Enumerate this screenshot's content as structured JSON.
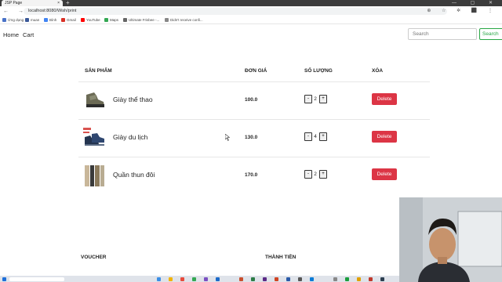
{
  "browser": {
    "tab_title": "JSP Page",
    "tab_close": "×",
    "new_tab": "+",
    "window_controls": "— ▢ ✕",
    "nav_buttons": "← → ⟳",
    "url": "localhost:8080/Wish/print",
    "right_icons": "⊕ ☆ ✲ ⬛ ⋮",
    "bookmarks": [
      {
        "label": "Ứng dụng",
        "color": "#4a73c8"
      },
      {
        "label": "muan",
        "color": "#3b5998"
      },
      {
        "label": "Bình",
        "color": "#4285f4"
      },
      {
        "label": "Gmail",
        "color": "#d93025"
      },
      {
        "label": "YouTube",
        "color": "#ff0000"
      },
      {
        "label": "Maps",
        "color": "#34a853"
      },
      {
        "label": "Ultimate Frisbee -...",
        "color": "#666666"
      },
      {
        "label": "Didn't receive confi...",
        "color": "#888888"
      }
    ]
  },
  "nav": {
    "home": "Home",
    "cart": "Cart",
    "search_placeholder": "Search",
    "search_button": "Search"
  },
  "cart": {
    "headers": {
      "product": "SẢN PHẨM",
      "price": "ĐƠN GIÁ",
      "quantity": "SỐ LƯỢNG",
      "delete": "XÓA"
    },
    "items": [
      {
        "name": "Giày thể thao",
        "price": "100.0",
        "qty": "2",
        "minus": "-",
        "plus": "+",
        "delete": "Delete",
        "image": "hiking-shoe-image"
      },
      {
        "name": "Giày du lịch",
        "price": "130.0",
        "qty": "4",
        "minus": "-",
        "plus": "+",
        "delete": "Delete",
        "image": "travel-shoe-image"
      },
      {
        "name": "Quần thun đôi",
        "price": "170.0",
        "qty": "2",
        "minus": "-",
        "plus": "+",
        "delete": "Delete",
        "image": "pants-image"
      }
    ]
  },
  "footer": {
    "voucher": "VOUCHER",
    "total": "THÀNH TIỀN"
  },
  "colors": {
    "delete_button": "#dc3545",
    "search_button": "#28a745"
  }
}
